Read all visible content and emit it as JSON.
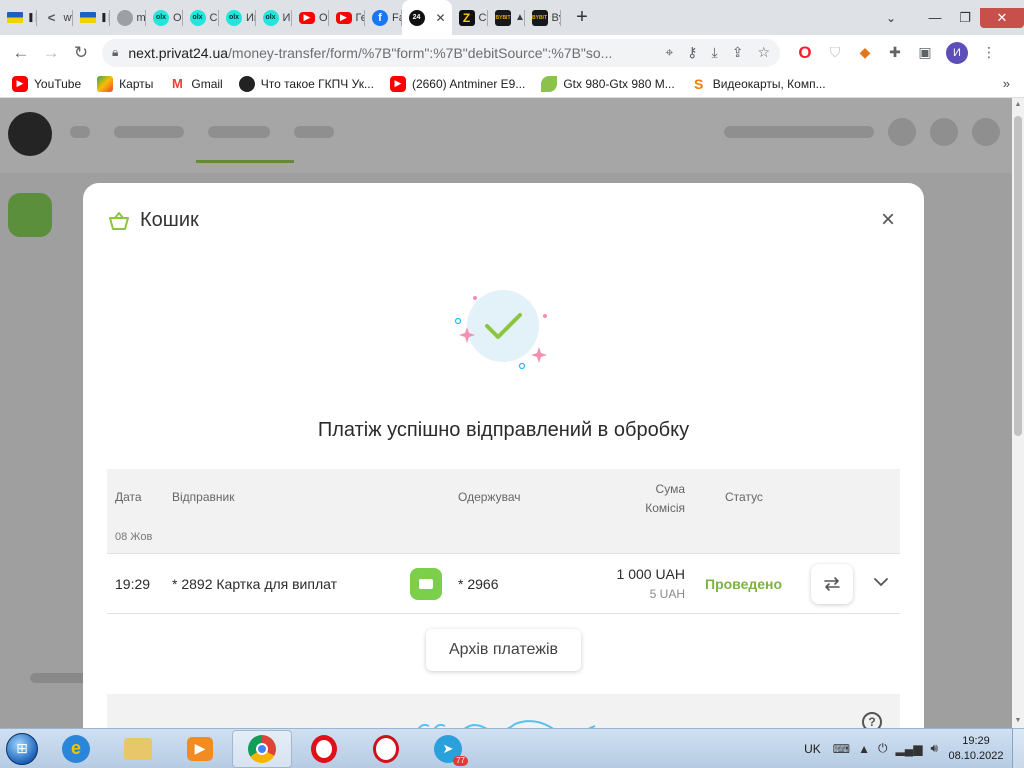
{
  "browser": {
    "tabs": [
      {
        "icon": "ukraine-flag-icon",
        "label": "",
        "playing": true
      },
      {
        "icon": "share-icon",
        "label": "wv"
      },
      {
        "icon": "ukraine-flag-icon",
        "label": "",
        "playing": true
      },
      {
        "icon": "grey-globe-icon",
        "label": "mi"
      },
      {
        "icon": "olx-icon",
        "label": "Ог"
      },
      {
        "icon": "olx-icon",
        "label": "Сп"
      },
      {
        "icon": "olx-icon",
        "label": "Ин"
      },
      {
        "icon": "olx-icon",
        "label": "Ин"
      },
      {
        "icon": "youtube-icon",
        "label": "О"
      },
      {
        "icon": "youtube-icon",
        "label": "Ге"
      },
      {
        "icon": "facebook-icon",
        "label": "Fa"
      },
      {
        "icon": "privat24-icon",
        "label": "",
        "active": true
      },
      {
        "icon": "yellow-z-icon",
        "label": "Ст"
      },
      {
        "icon": "bybit-icon",
        "label": ""
      },
      {
        "icon": "bybit-icon",
        "label": "By"
      }
    ],
    "url_host": "next.privat24.ua",
    "url_rest": "/money-transfer/form/%7B\"form\":%7B\"debitSource\":%7B\"so...",
    "profile_initial": "И"
  },
  "bookmarks": [
    {
      "icon": "youtube-icon",
      "label": "YouTube"
    },
    {
      "icon": "maps-icon",
      "label": "Карты"
    },
    {
      "icon": "gmail-icon",
      "label": "Gmail"
    },
    {
      "icon": "gkpch-icon",
      "label": "Что такое ГКПЧ Ук..."
    },
    {
      "icon": "youtube-icon",
      "label": "(2660) Antminer E9..."
    },
    {
      "icon": "leaf-icon",
      "label": "Gtx 980-Gtx 980 M..."
    },
    {
      "icon": "s-logo-icon",
      "label": "Видеокарты, Комп..."
    }
  ],
  "modal": {
    "title": "Кошик",
    "success_message": "Платіж успішно відправлений в обробку",
    "table": {
      "headers": {
        "date": "Дата",
        "sender": "Відправник",
        "receiver": "Одержувач",
        "amount": "Сума",
        "fee": "Комісія",
        "status": "Статус"
      },
      "group_date": "08 Жов",
      "rows": [
        {
          "time": "19:29",
          "sender": "* 2892 Картка для виплат",
          "receiver": "* 2966",
          "amount": "1 000 UAH",
          "fee": "5 UAH",
          "status": "Проведено"
        }
      ]
    },
    "archive_button": "Архів платежів"
  },
  "colors": {
    "accent_green": "#7cb342",
    "card_green": "#7ccf4a"
  },
  "taskbar": {
    "language": "UK",
    "time": "19:29",
    "date": "08.10.2022",
    "telegram_badge": "77"
  }
}
